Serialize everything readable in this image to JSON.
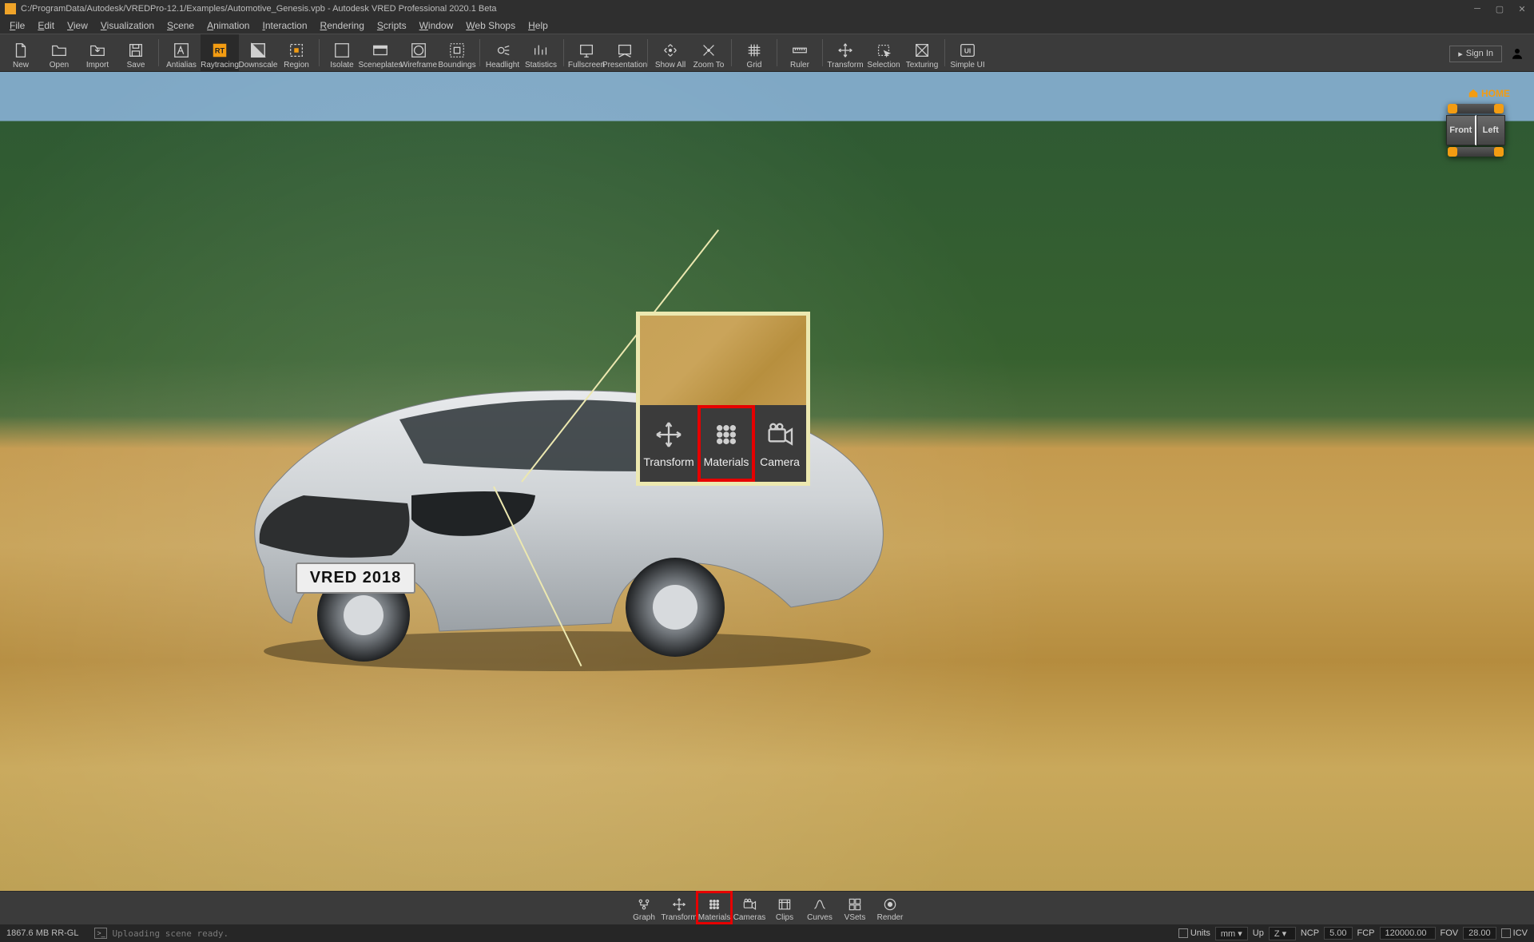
{
  "titlebar": {
    "path": "C:/ProgramData/Autodesk/VREDPro-12.1/Examples/Automotive_Genesis.vpb - Autodesk VRED Professional 2020.1 Beta"
  },
  "menubar": [
    "File",
    "Edit",
    "View",
    "Visualization",
    "Scene",
    "Animation",
    "Interaction",
    "Rendering",
    "Scripts",
    "Window",
    "Web Shops",
    "Help"
  ],
  "toolbar": {
    "groups": [
      [
        "New",
        "Open",
        "Import",
        "Save"
      ],
      [
        "Antialias",
        "Raytracing",
        "Downscale",
        "Region"
      ],
      [
        "Isolate",
        "Sceneplates",
        "Wireframe",
        "Boundings"
      ],
      [
        "Headlight",
        "Statistics"
      ],
      [
        "Fullscreen",
        "Presentation"
      ],
      [
        "Show All",
        "Zoom To"
      ],
      [
        "Grid"
      ],
      [
        "Ruler"
      ],
      [
        "Transform",
        "Selection",
        "Texturing"
      ],
      [
        "Simple UI"
      ]
    ],
    "active": "Raytracing",
    "signin": "Sign In"
  },
  "viewport": {
    "home": "HOME",
    "cube": {
      "front": "Front",
      "left": "Left"
    },
    "plate": "VRED 2018"
  },
  "callout": {
    "items": [
      "Transform",
      "Materials",
      "Camera"
    ],
    "highlight": "Materials"
  },
  "quickbar": {
    "items": [
      "Graph",
      "Transform",
      "Materials",
      "Cameras",
      "Clips",
      "Curves",
      "VSets",
      "Render"
    ],
    "highlight": "Materials"
  },
  "statusbar": {
    "memory": "1867.6 MB  RR-GL",
    "message": "Uploading scene ready.",
    "right": {
      "units_label": "Units",
      "units_value": "mm",
      "up_label": "Up",
      "up_value": "Z",
      "ncp_label": "NCP",
      "ncp_value": "5.00",
      "fcp_label": "FCP",
      "fcp_value": "120000.00",
      "fov_label": "FOV",
      "fov_value": "28.00",
      "icv_label": "ICV"
    }
  },
  "icons": {
    "New": "doc",
    "Open": "folder",
    "Import": "import",
    "Save": "disk",
    "Antialias": "aa",
    "Raytracing": "rt",
    "Downscale": "half",
    "Region": "region",
    "Isolate": "isolate",
    "Sceneplates": "plate",
    "Wireframe": "wire",
    "Boundings": "bounds",
    "Headlight": "light",
    "Statistics": "stats",
    "Fullscreen": "full",
    "Presentation": "present",
    "Show All": "showall",
    "Zoom To": "zoom",
    "Grid": "grid",
    "Ruler": "ruler",
    "Transform": "transform",
    "Selection": "select",
    "Texturing": "texture",
    "Simple UI": "simpleui",
    "Graph": "graph",
    "Materials": "materials",
    "Cameras": "camera",
    "Clips": "clips",
    "Curves": "curves",
    "VSets": "vsets",
    "Render": "render",
    "Camera": "camera"
  }
}
